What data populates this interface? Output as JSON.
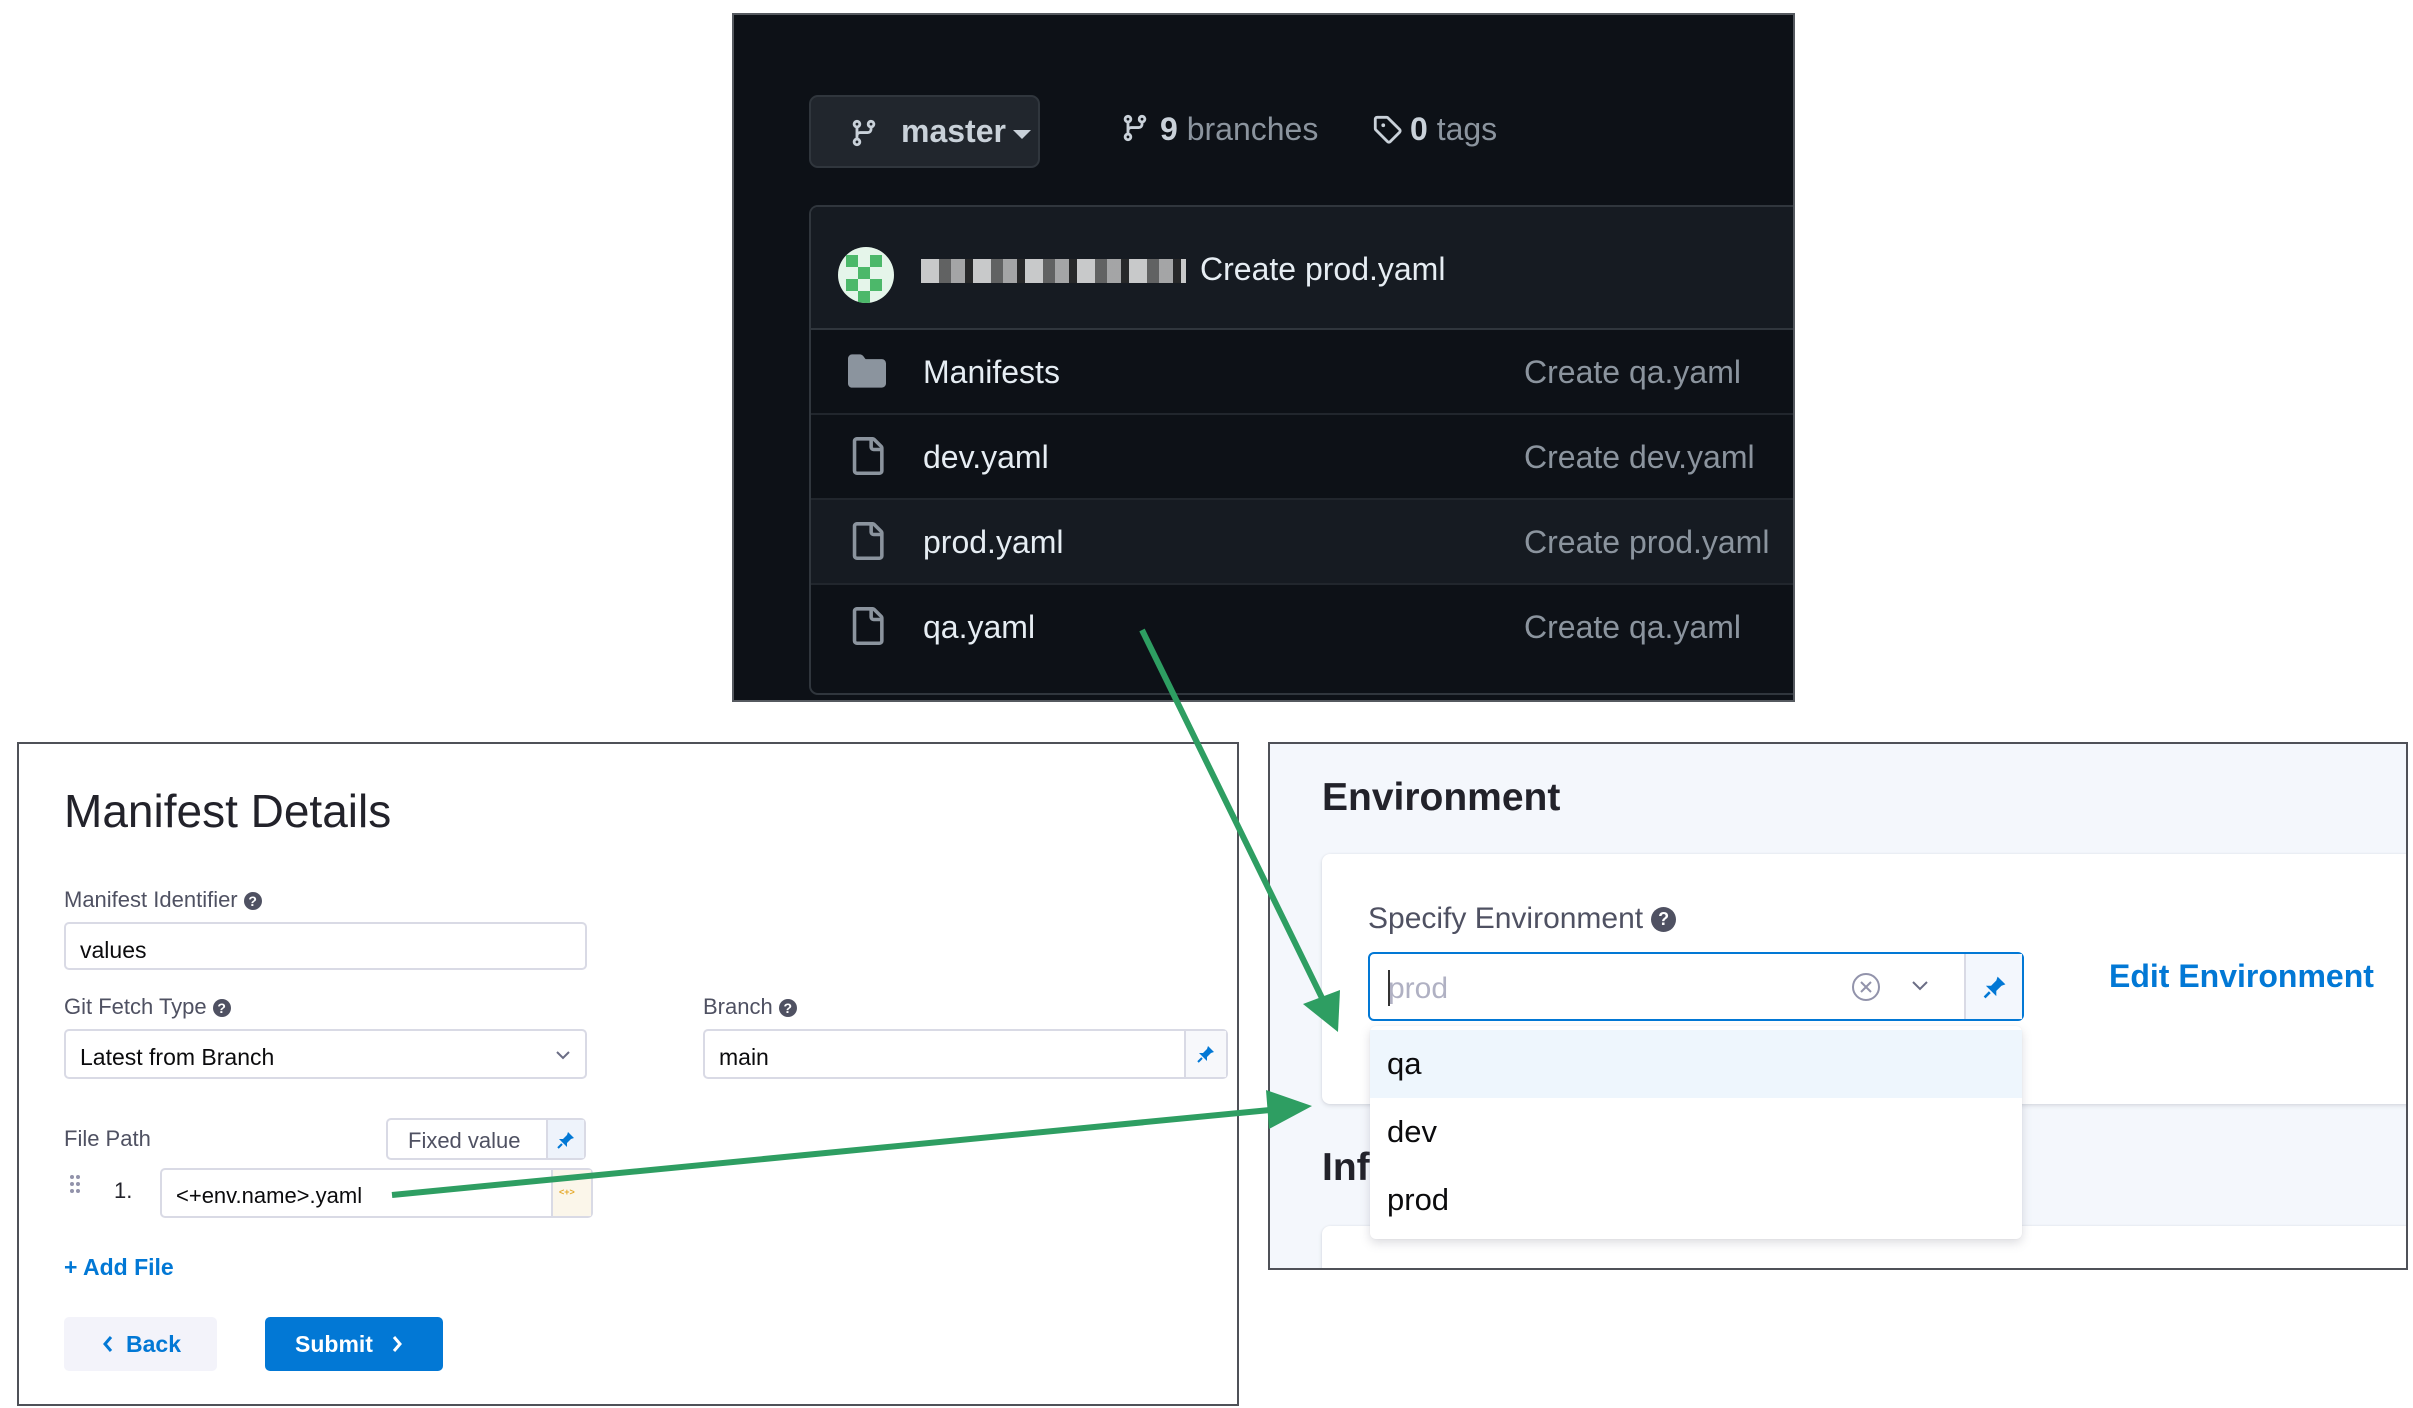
{
  "github": {
    "branch": "master",
    "branches_count": "9",
    "branches_label": "branches",
    "tags_count": "0",
    "tags_label": "tags",
    "latest_commit_message": "Create prod.yaml",
    "files": [
      {
        "name": "Manifests",
        "type": "folder",
        "commit": "Create qa.yaml"
      },
      {
        "name": "dev.yaml",
        "type": "file",
        "commit": "Create dev.yaml"
      },
      {
        "name": "prod.yaml",
        "type": "file",
        "commit": "Create prod.yaml"
      },
      {
        "name": "qa.yaml",
        "type": "file",
        "commit": "Create qa.yaml"
      }
    ]
  },
  "manifest": {
    "title": "Manifest Details",
    "identifier_label": "Manifest Identifier",
    "identifier_value": "values",
    "fetch_type_label": "Git Fetch Type",
    "fetch_type_value": "Latest from Branch",
    "branch_label": "Branch",
    "branch_value": "main",
    "file_path_label": "File Path",
    "fixed_value_label": "Fixed value",
    "file_index": "1.",
    "file_path_value": "<+env.name>.yaml",
    "add_file_label": "+ Add File",
    "back_label": "Back",
    "submit_label": "Submit"
  },
  "environment": {
    "section_title": "Environment",
    "specify_label": "Specify Environment",
    "placeholder": "prod",
    "edit_label": "Edit Environment",
    "next_section_partial": "Inf",
    "options": [
      "qa",
      "dev",
      "prod"
    ],
    "active_option": "qa"
  },
  "colors": {
    "accent": "#0278d5",
    "arrow": "#2e9e62",
    "github_bg": "#0d1117"
  }
}
